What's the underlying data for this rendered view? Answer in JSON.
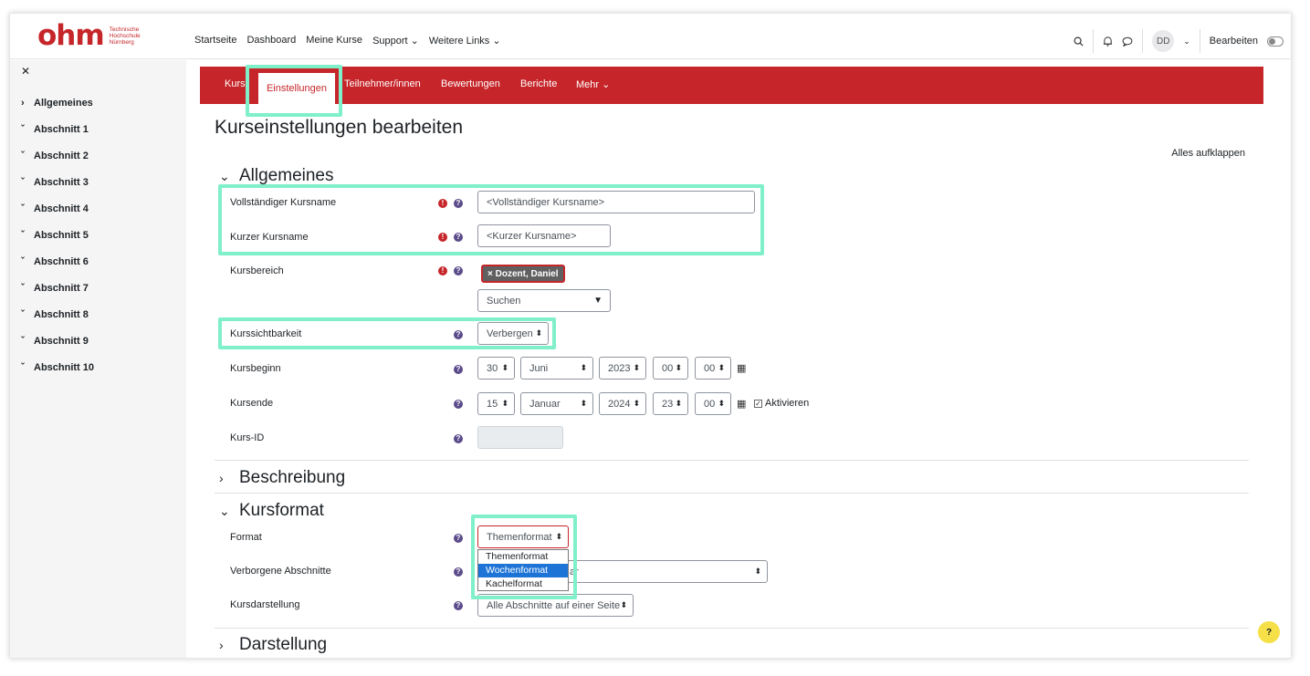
{
  "logo": {
    "word": "ohm",
    "sub": [
      "Technische",
      "Hochschule",
      "Nürnberg"
    ]
  },
  "topnav": [
    "Startseite",
    "Dashboard",
    "Meine Kurse",
    "Support ⌄",
    "Weitere Links ⌄"
  ],
  "topright": {
    "avatar": "DD",
    "edit_label": "Bearbeiten"
  },
  "drawer": {
    "close": "✕",
    "items": [
      "Allgemeines",
      "Abschnitt 1",
      "Abschnitt 2",
      "Abschnitt 3",
      "Abschnitt 4",
      "Abschnitt 5",
      "Abschnitt 6",
      "Abschnitt 7",
      "Abschnitt 8",
      "Abschnitt 9",
      "Abschnitt 10"
    ]
  },
  "tabs": {
    "kurs": "Kurs",
    "active": "Einstellungen",
    "teilnehmer": "Teilnehmer/innen",
    "bewertungen": "Bewertungen",
    "berichte": "Berichte",
    "mehr": "Mehr ⌄"
  },
  "page": {
    "title": "Kurseinstellungen bearbeiten",
    "expand_all": "Alles aufklappen"
  },
  "sections": {
    "allgemeines": "Allgemeines",
    "beschreibung": "Beschreibung",
    "kursformat": "Kursformat",
    "darstellung": "Darstellung"
  },
  "form": {
    "fullname_label": "Vollständiger Kursname",
    "fullname_value": "<Vollständiger Kursname>",
    "shortname_label": "Kurzer Kursname",
    "shortname_value": "<Kurzer Kursname>",
    "category_label": "Kursbereich",
    "category_chip": "× Dozent, Daniel",
    "category_search": "Suchen",
    "visibility_label": "Kurssichtbarkeit",
    "visibility_value": "Verbergen",
    "start_label": "Kursbeginn",
    "start": {
      "day": "30",
      "month": "Juni",
      "year": "2023",
      "hour": "00",
      "minute": "00"
    },
    "end_label": "Kursende",
    "end": {
      "day": "15",
      "month": "Januar",
      "year": "2024",
      "hour": "23",
      "minute": "00"
    },
    "end_enable": "Aktivieren",
    "idnumber_label": "Kurs-ID",
    "format_label": "Format",
    "format_value": "Themenformat",
    "format_options": [
      "Themenformat",
      "Wochenformat",
      "Kachelformat"
    ],
    "hidden_label": "Verborgene Abschnitte",
    "hidden_value_tail": "ar",
    "layout_label": "Kursdarstellung",
    "layout_value": "Alle Abschnitte auf einer Seite"
  },
  "help_fab": "?"
}
